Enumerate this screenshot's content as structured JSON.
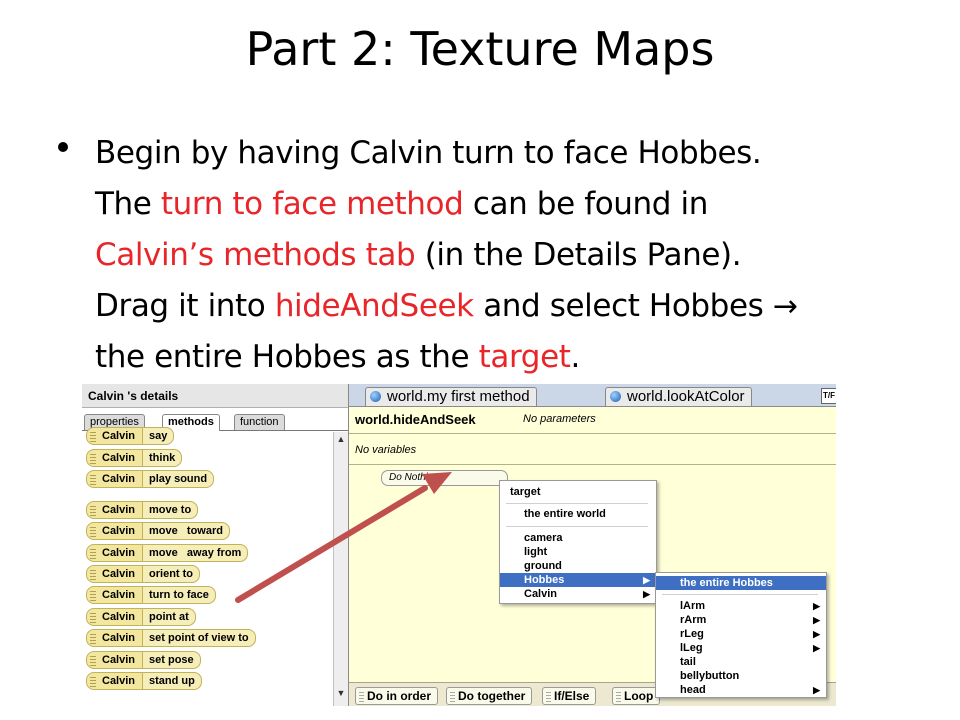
{
  "slide": {
    "title": "Part 2: Texture Maps",
    "bullet": {
      "s1": "Begin by having Calvin turn to face Hobbes.",
      "s2a": "The ",
      "s2b": "turn to face method",
      "s2c": " can be found in",
      "s3a": "Calvin’s methods tab",
      "s3b": " (in the Details Pane).",
      "s4a": "Drag it into ",
      "s4b": "hideAndSeek",
      "s4c": " and select Hobbes ",
      "s4d": "→",
      "s5a": "the entire Hobbes as the ",
      "s5b": "target",
      "s5c": "."
    },
    "accent_color": "#e8262a"
  },
  "details": {
    "title": "Calvin 's details",
    "tabs": [
      "properties",
      "methods",
      "function"
    ],
    "methods": [
      {
        "object": "Calvin",
        "action": "say"
      },
      {
        "object": "Calvin",
        "action": "think"
      },
      {
        "object": "Calvin",
        "action": "play sound"
      },
      {
        "object": "Calvin",
        "action": "move to"
      },
      {
        "object": "Calvin",
        "action": "move   toward"
      },
      {
        "object": "Calvin",
        "action": "move   away from"
      },
      {
        "object": "Calvin",
        "action": "orient to"
      },
      {
        "object": "Calvin",
        "action": "turn to face"
      },
      {
        "object": "Calvin",
        "action": "point at"
      },
      {
        "object": "Calvin",
        "action": "set point of view to"
      },
      {
        "object": "Calvin",
        "action": "set pose"
      },
      {
        "object": "Calvin",
        "action": "stand up"
      }
    ]
  },
  "editor": {
    "tabs": [
      "world.my first method",
      "world.lookAtColor"
    ],
    "tf_label": "T/F",
    "method_name": "world.hideAndSeek",
    "params": "No parameters",
    "vars": "No variables",
    "do_nothing": "Do Nothing",
    "controls": [
      "Do in order",
      "Do together",
      "If/Else",
      "Loop"
    ]
  },
  "menu": {
    "header": "target",
    "items": [
      "the entire world",
      "camera",
      "light",
      "ground",
      "Hobbes",
      "Calvin"
    ],
    "submenu": [
      "the entire Hobbes",
      "lArm",
      "rArm",
      "rLeg",
      "lLeg",
      "tail",
      "bellybutton",
      "head"
    ]
  },
  "icons": {
    "world_tab": "world-ball-icon",
    "submenu_arrow": "triangle-right-icon",
    "scroll_up": "triangle-up-icon",
    "scroll_down": "triangle-down-icon",
    "drag_arrow": "red-arrow-icon"
  }
}
